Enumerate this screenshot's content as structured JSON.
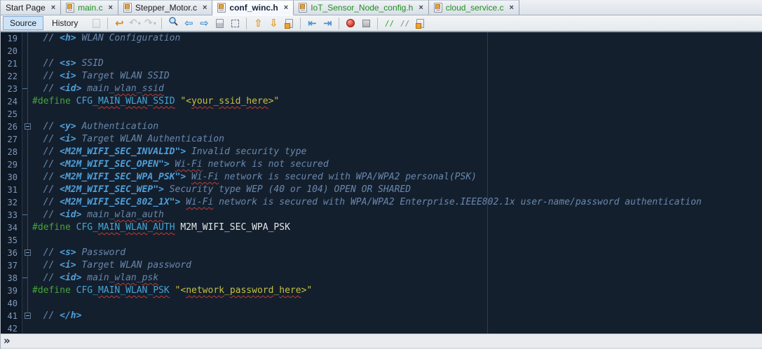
{
  "tabs": [
    {
      "label": "Start Page",
      "icon": null,
      "state": "normal",
      "active": false
    },
    {
      "label": "main.c",
      "icon": "c-file-icon",
      "state": "new",
      "active": false
    },
    {
      "label": "Stepper_Motor.c",
      "icon": "c-file-icon",
      "state": "normal",
      "active": false
    },
    {
      "label": "conf_winc.h",
      "icon": "h-file-icon",
      "state": "normal",
      "active": true
    },
    {
      "label": "IoT_Sensor_Node_config.h",
      "icon": "h-file-icon",
      "state": "new",
      "active": false
    },
    {
      "label": "cloud_service.c",
      "icon": "c-file-icon",
      "state": "new",
      "active": false
    }
  ],
  "tab_close_glyph": "×",
  "toolbar": {
    "source_label": "Source",
    "history_label": "History",
    "icons": [
      {
        "kind": "page",
        "name": "diff-icon",
        "disabled": true
      },
      {
        "kind": "sep"
      },
      {
        "kind": "last-edit",
        "name": "last-edit-location-icon"
      },
      {
        "kind": "back",
        "name": "back-icon",
        "disabled": true,
        "dropdown": true
      },
      {
        "kind": "forward",
        "name": "forward-icon",
        "disabled": true,
        "dropdown": true
      },
      {
        "kind": "sep"
      },
      {
        "kind": "find",
        "name": "find-selection-icon"
      },
      {
        "kind": "arrow-left",
        "name": "find-previous-occurrence-icon"
      },
      {
        "kind": "arrow-right",
        "name": "find-next-occurrence-icon"
      },
      {
        "kind": "highlight",
        "name": "toggle-highlight-search-icon"
      },
      {
        "kind": "rect-select",
        "name": "rectangular-selection-icon"
      },
      {
        "kind": "sep"
      },
      {
        "kind": "arrow-up",
        "name": "previous-bookmark-icon"
      },
      {
        "kind": "arrow-down",
        "name": "next-bookmark-icon"
      },
      {
        "kind": "bookmark",
        "name": "toggle-bookmark-icon"
      },
      {
        "kind": "sep"
      },
      {
        "kind": "shift-left",
        "name": "shift-line-left-icon"
      },
      {
        "kind": "shift-right",
        "name": "shift-line-right-icon"
      },
      {
        "kind": "sep"
      },
      {
        "kind": "record",
        "name": "start-macro-recording-icon"
      },
      {
        "kind": "stop",
        "name": "stop-macro-recording-icon"
      },
      {
        "kind": "sep"
      },
      {
        "kind": "comment",
        "name": "comment-icon"
      },
      {
        "kind": "uncomment",
        "name": "uncomment-icon"
      },
      {
        "kind": "header-source",
        "name": "go-to-header-source-icon"
      }
    ]
  },
  "editor": {
    "lines": [
      {
        "n": 19,
        "s": [
          [
            "c",
            "  // "
          ],
          [
            "t",
            "<h>"
          ],
          [
            "c",
            " WLAN Configuration"
          ]
        ]
      },
      {
        "n": 20,
        "s": []
      },
      {
        "n": 21,
        "s": [
          [
            "c",
            "  // "
          ],
          [
            "t",
            "<s>"
          ],
          [
            "c",
            " SSID"
          ]
        ]
      },
      {
        "n": 22,
        "s": [
          [
            "c",
            "  // "
          ],
          [
            "t",
            "<i>"
          ],
          [
            "c",
            " Target WLAN SSID"
          ]
        ]
      },
      {
        "n": 23,
        "fold": "end",
        "s": [
          [
            "c",
            "  // "
          ],
          [
            "t",
            "<id>"
          ],
          [
            "c",
            " main_"
          ],
          [
            "cw",
            "wlan"
          ],
          [
            "c",
            "_"
          ],
          [
            "cw",
            "ssid"
          ]
        ]
      },
      {
        "n": 24,
        "s": [
          [
            "p",
            "#define"
          ],
          [
            "d",
            " "
          ],
          [
            "m",
            "CFG_"
          ],
          [
            "mw",
            "MAIN"
          ],
          [
            "m",
            "_"
          ],
          [
            "mw",
            "WLAN"
          ],
          [
            "m",
            "_"
          ],
          [
            "mw",
            "SSID"
          ],
          [
            "d",
            " "
          ],
          [
            "s",
            "\"<"
          ],
          [
            "sw",
            "your"
          ],
          [
            "s",
            "_"
          ],
          [
            "sw",
            "ssid"
          ],
          [
            "s",
            "_"
          ],
          [
            "sw",
            "here"
          ],
          [
            "s",
            ">\""
          ]
        ]
      },
      {
        "n": 25,
        "s": []
      },
      {
        "n": 26,
        "fold": "box",
        "s": [
          [
            "c",
            "  // "
          ],
          [
            "t",
            "<y>"
          ],
          [
            "c",
            " Authentication"
          ]
        ]
      },
      {
        "n": 27,
        "s": [
          [
            "c",
            "  // "
          ],
          [
            "t",
            "<i>"
          ],
          [
            "c",
            " Target WLAN Authentication"
          ]
        ]
      },
      {
        "n": 28,
        "s": [
          [
            "c",
            "  // "
          ],
          [
            "t",
            "<M2M_WIFI_SEC_INVALID\">"
          ],
          [
            "c",
            " Invalid security type"
          ]
        ]
      },
      {
        "n": 29,
        "s": [
          [
            "c",
            "  // "
          ],
          [
            "t",
            "<M2M_WIFI_SEC_OPEN\">"
          ],
          [
            "c",
            " "
          ],
          [
            "cw",
            "Wi-Fi"
          ],
          [
            "c",
            " network is not secured"
          ]
        ]
      },
      {
        "n": 30,
        "s": [
          [
            "c",
            "  // "
          ],
          [
            "t",
            "<M2M_WIFI_SEC_WPA_PSK\">"
          ],
          [
            "c",
            " "
          ],
          [
            "cw",
            "Wi-Fi"
          ],
          [
            "c",
            " network is secured with WPA/WPA2 personal(PSK)"
          ]
        ]
      },
      {
        "n": 31,
        "s": [
          [
            "c",
            "  // "
          ],
          [
            "t",
            "<M2M_WIFI_SEC_WEP\">"
          ],
          [
            "c",
            " Security type WEP (40 or 104) OPEN OR SHARED"
          ]
        ]
      },
      {
        "n": 32,
        "s": [
          [
            "c",
            "  // "
          ],
          [
            "t",
            "<M2M_WIFI_SEC_802_1X\">"
          ],
          [
            "c",
            " "
          ],
          [
            "cw",
            "Wi-Fi"
          ],
          [
            "c",
            " network is secured with WPA/WPA2 Enterprise.IEEE802.1x user-name/password authentication"
          ]
        ]
      },
      {
        "n": 33,
        "fold": "end",
        "s": [
          [
            "c",
            "  // "
          ],
          [
            "t",
            "<id>"
          ],
          [
            "c",
            " main_"
          ],
          [
            "cw",
            "wlan"
          ],
          [
            "c",
            "_"
          ],
          [
            "cw",
            "auth"
          ]
        ]
      },
      {
        "n": 34,
        "s": [
          [
            "p",
            "#define"
          ],
          [
            "d",
            " "
          ],
          [
            "m",
            "CFG_"
          ],
          [
            "mw",
            "MAIN"
          ],
          [
            "m",
            "_"
          ],
          [
            "mw",
            "WLAN"
          ],
          [
            "m",
            "_"
          ],
          [
            "mw",
            "AUTH"
          ],
          [
            "d",
            " "
          ],
          [
            "v",
            "M2M_WIFI_SEC_WPA_PSK"
          ]
        ]
      },
      {
        "n": 35,
        "s": []
      },
      {
        "n": 36,
        "fold": "box",
        "s": [
          [
            "c",
            "  // "
          ],
          [
            "t",
            "<s>"
          ],
          [
            "c",
            " Password"
          ]
        ]
      },
      {
        "n": 37,
        "s": [
          [
            "c",
            "  // "
          ],
          [
            "t",
            "<i>"
          ],
          [
            "c",
            " Target WLAN password"
          ]
        ]
      },
      {
        "n": 38,
        "fold": "end",
        "s": [
          [
            "c",
            "  // "
          ],
          [
            "t",
            "<id>"
          ],
          [
            "c",
            " main_"
          ],
          [
            "cw",
            "wlan"
          ],
          [
            "c",
            "_"
          ],
          [
            "cw",
            "psk"
          ]
        ]
      },
      {
        "n": 39,
        "s": [
          [
            "p",
            "#define"
          ],
          [
            "d",
            " "
          ],
          [
            "m",
            "CFG_"
          ],
          [
            "mw",
            "MAIN"
          ],
          [
            "m",
            "_"
          ],
          [
            "mw",
            "WLAN"
          ],
          [
            "m",
            "_"
          ],
          [
            "mw",
            "PSK"
          ],
          [
            "d",
            " "
          ],
          [
            "s",
            "\"<"
          ],
          [
            "sw",
            "network"
          ],
          [
            "s",
            "_"
          ],
          [
            "sw",
            "password"
          ],
          [
            "s",
            "_"
          ],
          [
            "sw",
            "here"
          ],
          [
            "s",
            ">\""
          ]
        ]
      },
      {
        "n": 40,
        "s": []
      },
      {
        "n": 41,
        "fold": "box",
        "s": [
          [
            "c",
            "  // "
          ],
          [
            "t",
            "</h>"
          ]
        ]
      },
      {
        "n": 42,
        "s": []
      }
    ]
  },
  "bottom_bar": {
    "chevron": "»"
  },
  "colors": {
    "editor_bg": "#141f2e",
    "gutter_bg": "#0f1926",
    "gutter_border": "#273748",
    "fold_line": "#33475c",
    "line_number": "#7e9abd",
    "comment": "#6888ac",
    "comment_tag": "#4f9fd8",
    "preprocessor": "#43a538",
    "macro": "#47a5d4",
    "string": "#c4c23e",
    "plain": "#e2e5e8",
    "squiggle": "#c23b2e",
    "margin_guide": "#2b3e54",
    "tab_active_text": "#16253c",
    "tab_modified_text": "#1f8f1f",
    "tab_text": "#1c1c1c",
    "toolbar_border": "#8ca6c0",
    "source_button_bg": "#cde3f7",
    "bottom_bar_bg": "#e9ebee",
    "chevron": "#20344a"
  }
}
